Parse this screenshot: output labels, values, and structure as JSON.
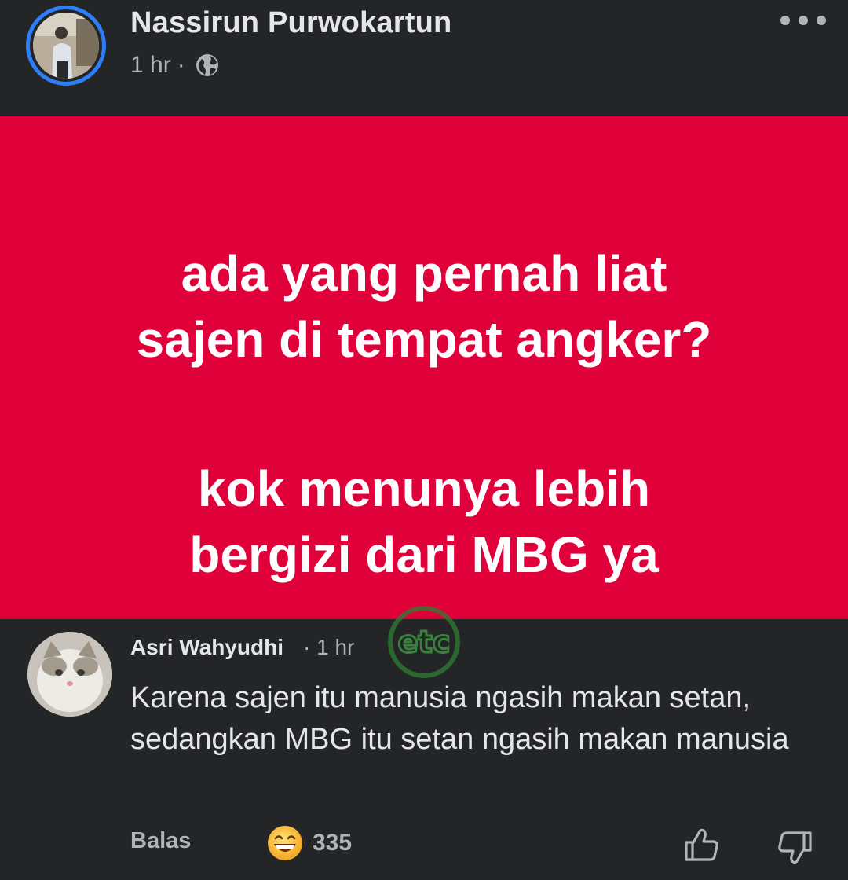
{
  "post": {
    "author": "Nassirun Purwokartun",
    "time": "1 hr",
    "separator": "·",
    "privacy_icon": "globe-icon",
    "more_icon": "ellipsis-icon",
    "background_color": "#e0003a",
    "lines": [
      "ada yang pernah liat",
      "sajen di tempat angker?",
      "kok menunya lebih",
      "bergizi dari MBG ya"
    ]
  },
  "comment": {
    "author": "Asri Wahyudhi",
    "time": "· 1 hr",
    "text": "Karena sajen itu manusia ngasih makan setan, sedangkan MBG itu setan ngasih makan manusia",
    "reply_label": "Balas",
    "reaction_icon": "grinning-face-icon",
    "reaction_count": "335",
    "like_icon": "thumbs-up-icon",
    "dislike_icon": "thumbs-down-icon"
  },
  "watermark": {
    "icon": "etc-logo-icon",
    "text": "etc"
  },
  "colors": {
    "background": "#242526",
    "accent_ring": "#2d7ff9",
    "primary_text": "#e4e6eb",
    "secondary_text": "#b0b3b8"
  }
}
